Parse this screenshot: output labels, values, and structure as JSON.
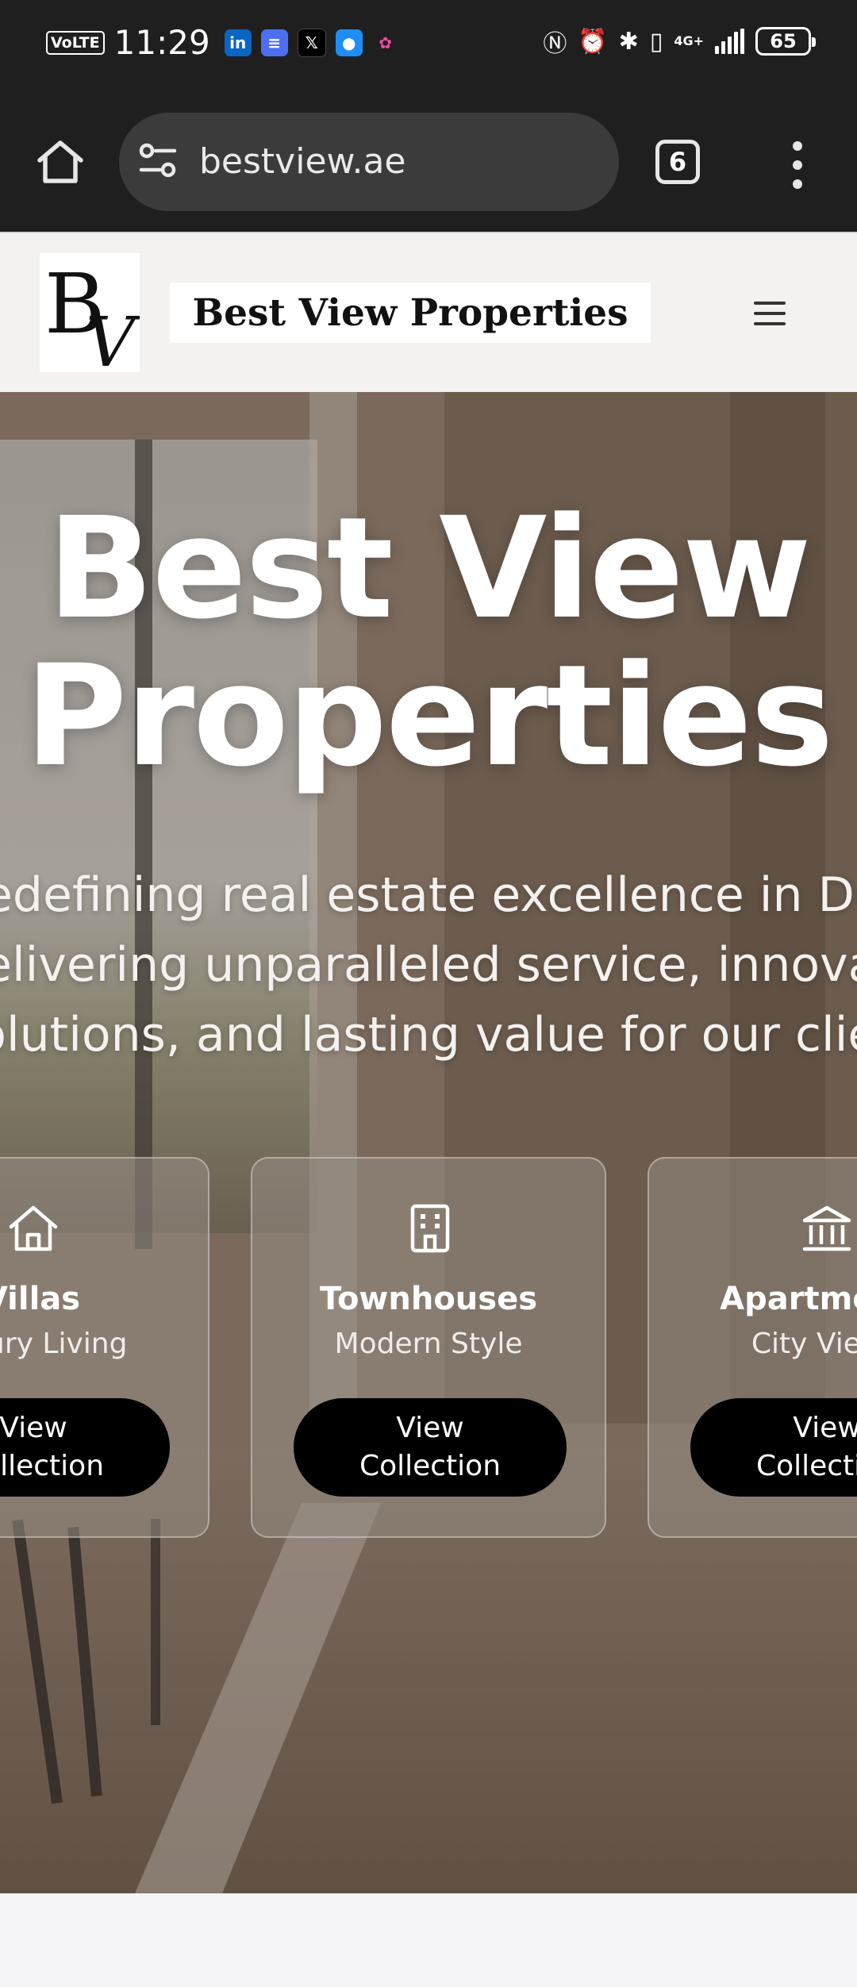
{
  "status_bar": {
    "volte": "VoLTE",
    "time": "11:29",
    "network": "4G+",
    "battery": "65",
    "notification_icons": [
      "linkedin-icon",
      "tasks-icon",
      "x-icon",
      "chat-icon",
      "photos-icon"
    ]
  },
  "browser": {
    "url": "bestview.ae",
    "tab_count": "6"
  },
  "header": {
    "logo_letters": "BV",
    "brand_name": "Best View Properties"
  },
  "hero": {
    "title": "Best View Properties",
    "subtitle_lines": [
      "Redefining real estate excellence in Dubai,",
      "delivering unparalleled service, innovative",
      "solutions, and lasting value for our clients"
    ]
  },
  "cards": [
    {
      "icon": "house-icon",
      "title": "Villas",
      "subtitle": "Luxury Living",
      "button": "View\nCollection"
    },
    {
      "icon": "building-icon",
      "title": "Townhouses",
      "subtitle": "Modern Style",
      "button": "View\nCollection"
    },
    {
      "icon": "bank-icon",
      "title": "Apartments",
      "subtitle": "City Views",
      "button": "View\nCollection"
    }
  ],
  "colors": {
    "chrome_dark": "#1f1f1f",
    "url_pill": "#3b3b3b",
    "header_bg": "#f3f2f0",
    "button_black": "#000000"
  }
}
